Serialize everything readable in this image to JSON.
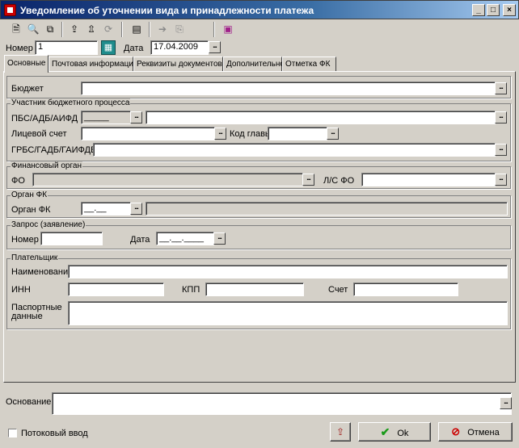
{
  "window": {
    "title": "Уведомление об уточнении вида и принадлежности платежа",
    "min": "_",
    "max": "□",
    "close": "×"
  },
  "header": {
    "number_label": "Номер",
    "number_value": "1",
    "date_label": "Дата",
    "date_value": "17.04.2009"
  },
  "tabs": [
    {
      "label": "Основные"
    },
    {
      "label": "Почтовая информация"
    },
    {
      "label": "Реквизиты документов"
    },
    {
      "label": "Дополнительно"
    },
    {
      "label": "Отметка ФК"
    }
  ],
  "ellipsis": "...",
  "budget": {
    "label": "Бюджет"
  },
  "participant": {
    "title": "Участник бюджетного процесса",
    "pbs_label": "ПБС/АДБ/АИФД",
    "pbs_code": "_____",
    "account_label": "Лицевой счет",
    "chapter_label": "Код главы",
    "grbs_label": "ГРБС/ГАДБ/ГАИФДБ"
  },
  "fin_org": {
    "title": "Финансовый орган",
    "fo_label": "ФО",
    "ls_label": "Л/С ФО"
  },
  "fk": {
    "title": "Орган ФК",
    "label": "Орган ФК",
    "code": "__.__"
  },
  "request": {
    "title": "Запрос (заявление)",
    "number_label": "Номер",
    "date_label": "Дата",
    "date_mask": "__.__.____"
  },
  "payer": {
    "title": "Плательщик",
    "name_label": "Наименование",
    "inn_label": "ИНН",
    "kpp_label": "КПП",
    "account_label": "Счет",
    "passport_label1": "Паспортные",
    "passport_label2": "данные"
  },
  "basis": {
    "label": "Основание"
  },
  "footer": {
    "stream_label": "Потоковый ввод",
    "ok_label": "Ok",
    "cancel_label": "Отмена"
  }
}
